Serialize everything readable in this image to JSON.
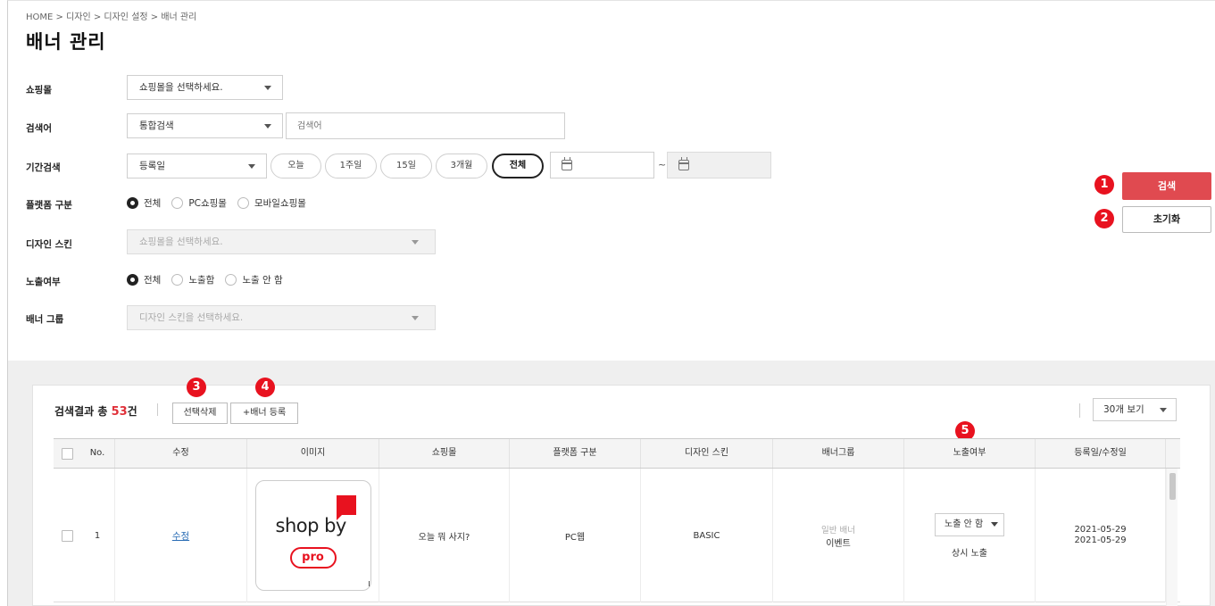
{
  "breadcrumb": "HOME > 디자인 > 디자인 설정 > 배너 관리",
  "page_title": "배너 관리",
  "filters": {
    "mall": {
      "label": "쇼핑몰",
      "value": "쇼핑몰을 선택하세요."
    },
    "keyword": {
      "label": "검색어",
      "type_value": "통합검색",
      "placeholder": "검색어"
    },
    "period": {
      "label": "기간검색",
      "type_value": "등록일",
      "pills": [
        "오늘",
        "1주일",
        "15일",
        "3개월",
        "전체"
      ],
      "active_pill": "전체"
    },
    "platform": {
      "label": "플랫폼 구분",
      "options": [
        "전체",
        "PC쇼핑몰",
        "모바일쇼핑몰"
      ],
      "selected": "전체"
    },
    "skin": {
      "label": "디자인 스킨",
      "value": "쇼핑몰을 선택하세요."
    },
    "exposure": {
      "label": "노출여부",
      "options": [
        "전체",
        "노출함",
        "노출 안 함"
      ],
      "selected": "전체"
    },
    "group": {
      "label": "배너 그룹",
      "value": "디자인 스킨을 선택하세요."
    }
  },
  "actions": {
    "search": "검색",
    "reset": "초기화"
  },
  "badges": [
    "1",
    "2",
    "3",
    "4",
    "5"
  ],
  "results": {
    "prefix": "검색결과 총",
    "count": "53",
    "unit": "건",
    "delete_label": "선택삭제",
    "add_label": "+배너 등록",
    "view_label": "30개 보기"
  },
  "table": {
    "headers": [
      "No.",
      "수정",
      "이미지",
      "쇼핑몰",
      "플랫폼 구분",
      "디자인 스킨",
      "배너그룹",
      "노출여부",
      "등록일/수정일"
    ],
    "rows": [
      {
        "no": "1",
        "edit": "수정",
        "image": {
          "logo_text": "shop by",
          "pro_text": "pro"
        },
        "mall": "오늘 뭐 사지?",
        "platform": "PC웹",
        "skin": "BASIC",
        "group_type": "일반 배너",
        "group_name": "이벤트",
        "exposure_select": "노출 안 함",
        "exposure_status": "상시 노출",
        "registered": "2021-05-29",
        "modified": "2021-05-29"
      }
    ]
  },
  "colors": {
    "accent": "#e04a50",
    "badge": "#e8121f",
    "link": "#2a6db5"
  }
}
